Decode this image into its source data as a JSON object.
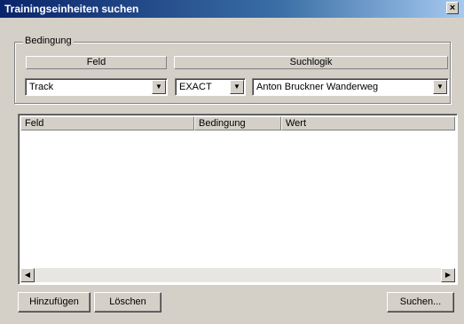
{
  "window": {
    "title": "Trainingseinheiten suchen",
    "close_glyph": "×"
  },
  "condition_group": {
    "legend": "Bedingung",
    "header_field": "Feld",
    "header_logic": "Suchlogik",
    "field_value": "Track",
    "operator_value": "EXACT",
    "value_value": "Anton Bruckner Wanderweg"
  },
  "table": {
    "columns": [
      "Feld",
      "Bedingung",
      "Wert"
    ],
    "rows": []
  },
  "buttons": {
    "add": "Hinzufügen",
    "delete": "Löschen",
    "search": "Suchen..."
  },
  "icons": {
    "dropdown": "chevron-down-icon",
    "scroll_left": "arrow-left-icon",
    "scroll_right": "arrow-right-icon"
  }
}
